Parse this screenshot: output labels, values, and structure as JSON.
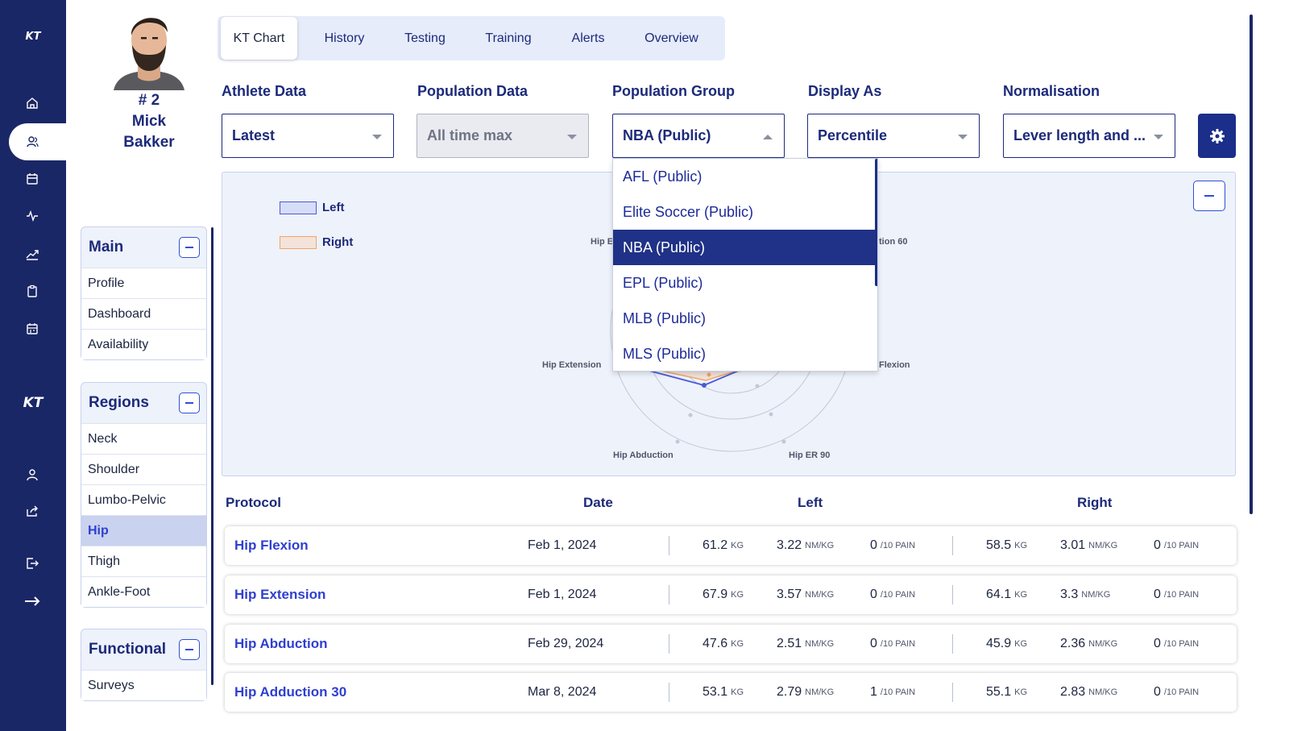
{
  "app": {
    "logo_top": "KT",
    "logo_mid": "KT"
  },
  "nav_icons": [
    "home-icon",
    "users-icon",
    "calendar-icon",
    "activity-icon",
    "trend-icon",
    "clipboard-icon",
    "calendar-grid-icon",
    "user-icon",
    "share-icon",
    "logout-icon",
    "arrow-right-icon"
  ],
  "athlete": {
    "number": "# 2",
    "first_name": "Mick",
    "last_name": "Bakker"
  },
  "sidebar": {
    "main": {
      "title": "Main",
      "items": [
        "Profile",
        "Dashboard",
        "Availability"
      ]
    },
    "regions": {
      "title": "Regions",
      "items": [
        "Neck",
        "Shoulder",
        "Lumbo-Pelvic",
        "Hip",
        "Thigh",
        "Ankle-Foot"
      ],
      "selected": "Hip"
    },
    "functional": {
      "title": "Functional",
      "items": [
        "Surveys"
      ]
    }
  },
  "tabs": [
    "KT Chart",
    "History",
    "Testing",
    "Training",
    "Alerts",
    "Overview"
  ],
  "active_tab": "KT Chart",
  "filters": {
    "athlete_data": {
      "label": "Athlete Data",
      "value": "Latest"
    },
    "population_data": {
      "label": "Population Data",
      "value": "All time max",
      "disabled": true
    },
    "population_group": {
      "label": "Population Group",
      "value": "NBA (Public)",
      "open": true
    },
    "display_as": {
      "label": "Display As",
      "value": "Percentile"
    },
    "normalisation": {
      "label": "Normalisation",
      "value": "Lever length and ..."
    }
  },
  "dropdown_options": [
    "AFL (Public)",
    "Elite Soccer (Public)",
    "NBA (Public)",
    "EPL (Public)",
    "MLB (Public)",
    "MLS (Public)"
  ],
  "dropdown_selected": "NBA (Public)",
  "chart": {
    "legend": [
      {
        "name": "Left",
        "fill": "#d6ddf7",
        "stroke": "#4a5bd8"
      },
      {
        "name": "Right",
        "fill": "#f3e3da",
        "stroke": "#f0a56a"
      }
    ],
    "axis_labels_visible": [
      "Hip E",
      "tion 60",
      "Hip Extension",
      "Flexion",
      "Hip Abduction",
      "Hip ER 90"
    ]
  },
  "table": {
    "headers": {
      "protocol": "Protocol",
      "date": "Date",
      "left": "Left",
      "right": "Right"
    },
    "units": {
      "kg": "KG",
      "nmkg": "NM/KG",
      "pain": "/10 PAIN"
    },
    "rows": [
      {
        "protocol": "Hip Flexion",
        "date": "Feb 1, 2024",
        "left_kg": "61.2",
        "left_nm": "3.22",
        "left_pain": "0",
        "right_kg": "58.5",
        "right_nm": "3.01",
        "right_pain": "0"
      },
      {
        "protocol": "Hip Extension",
        "date": "Feb 1, 2024",
        "left_kg": "67.9",
        "left_nm": "3.57",
        "left_pain": "0",
        "right_kg": "64.1",
        "right_nm": "3.3",
        "right_pain": "0"
      },
      {
        "protocol": "Hip Abduction",
        "date": "Feb 29, 2024",
        "left_kg": "47.6",
        "left_nm": "2.51",
        "left_pain": "0",
        "right_kg": "45.9",
        "right_nm": "2.36",
        "right_pain": "0"
      },
      {
        "protocol": "Hip Adduction 30",
        "date": "Mar 8, 2024",
        "left_kg": "53.1",
        "left_nm": "2.79",
        "left_pain": "1",
        "right_kg": "55.1",
        "right_nm": "2.83",
        "right_pain": "0"
      }
    ]
  }
}
